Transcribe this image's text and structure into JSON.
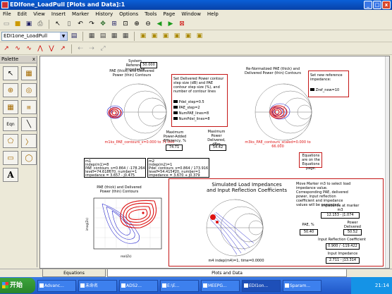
{
  "window": {
    "title": "EDIfone_LoadPull [Plots and Data]:1"
  },
  "menu": [
    "File",
    "Edit",
    "View",
    "Insert",
    "Marker",
    "History",
    "Options",
    "Tools",
    "Page",
    "Window",
    "Help"
  ],
  "toolbar": {
    "combo_value": "EDI1one_LoadPull"
  },
  "palette": {
    "title": "Palette",
    "close": "x",
    "items": [
      "arrow",
      "grid-table",
      "crosshair-circle",
      "target-circle",
      "table",
      "data-list",
      "text-eqn",
      "diagonal-line",
      "polygon",
      "polyline",
      "rectangle",
      "circle",
      "text-A"
    ]
  },
  "doc": {
    "smith1": {
      "ref_label": "System Reference Impedance",
      "ref_value": "50.000",
      "title": "PAE (thick) and Delivered Power (thin) Contours",
      "marker_text": "m1ks_PAE_contours_s=0.000 to 71.000"
    },
    "set_power": {
      "title": "Set Delivered Power contour step size (dB) and PAE contour step size (%), and number of contour lines",
      "p1": "Pdel_step=0.5",
      "p2": "PAE_step=2",
      "p3": "NumPAE_lines=8",
      "p4": "NumPdel_lines=8"
    },
    "max_pae": {
      "label": "Maximum Power-Added Efficiency, %",
      "value": "74.71"
    },
    "max_pdel": {
      "label": "Maximum Power Delivered, dBm",
      "value": "54.42"
    },
    "smith2": {
      "title": "Re-Normalized PAE (thick) and Delivered Power (thin) Contours",
      "marker_text": "m3ks_PAE_contours_scaled=0.000 to 66.000",
      "set_ref": "Set new reference impedance:",
      "zref": "Zref_new=10",
      "equations_note": "Equations are on the Equations page."
    },
    "m1_box": {
      "l1": "m1",
      "l2": "indep(m1)=8",
      "l3": "PAE_contours_s=0.864 / -178.264",
      "l4": "level=74.618670, number=1",
      "l5": "impedance = 3.657 - j0.475"
    },
    "m2_box": {
      "l1": "m2",
      "l2": "indep(m2)=1",
      "l3": "Pdel_contours_s=0.864 / 173.916",
      "l4": "level=54.415420, number=1",
      "l5": "impedance = 3.670 + j0.379"
    },
    "cart": {
      "title": "PAE (thick) and Delivered Power (thin) Contours",
      "ylabel": "imag(Zs)",
      "xlabel": "real(Zs)"
    },
    "sim": {
      "title1": "Simulated Load Impedances",
      "title2": "and Input Reflection Coefficients",
      "marker_text": "m4 indep(m4)=1, time=0.0000",
      "move_marker": "Move Marker m3 to select load impedance value. Corresponding PAE, delivered power, input reflection coefficient and impedance values will be computed.",
      "imp_label": "Impedance at marker m3",
      "imp_value": "12.153 - j1.074",
      "pae_label": "PAE, %",
      "pae_value": "50.40",
      "pdel_label": "Power Delivered (dBm)",
      "pdel_value": "50.52",
      "irc_label": "Input Reflection Coefficient",
      "irc_value": "0.900 / -119.422",
      "ii_label": "Input Impedance",
      "ii_value": "2.711 - j13.314"
    }
  },
  "tabs": {
    "equations": "Equations",
    "plots": "Plots and Data"
  },
  "taskbar": {
    "start": "开始",
    "tasks": [
      "Advanc...",
      "未命名",
      "ADS2...",
      "E:\\E...",
      "MEEPG...",
      "EDI1on...",
      "Sparam..."
    ],
    "clock": "21:14"
  },
  "colors": {
    "title_blue": "#0a5fd8",
    "contour_red": "#d11",
    "contour_blue": "#22c",
    "box_red": "#c41616",
    "marker_pink": "#d11"
  }
}
